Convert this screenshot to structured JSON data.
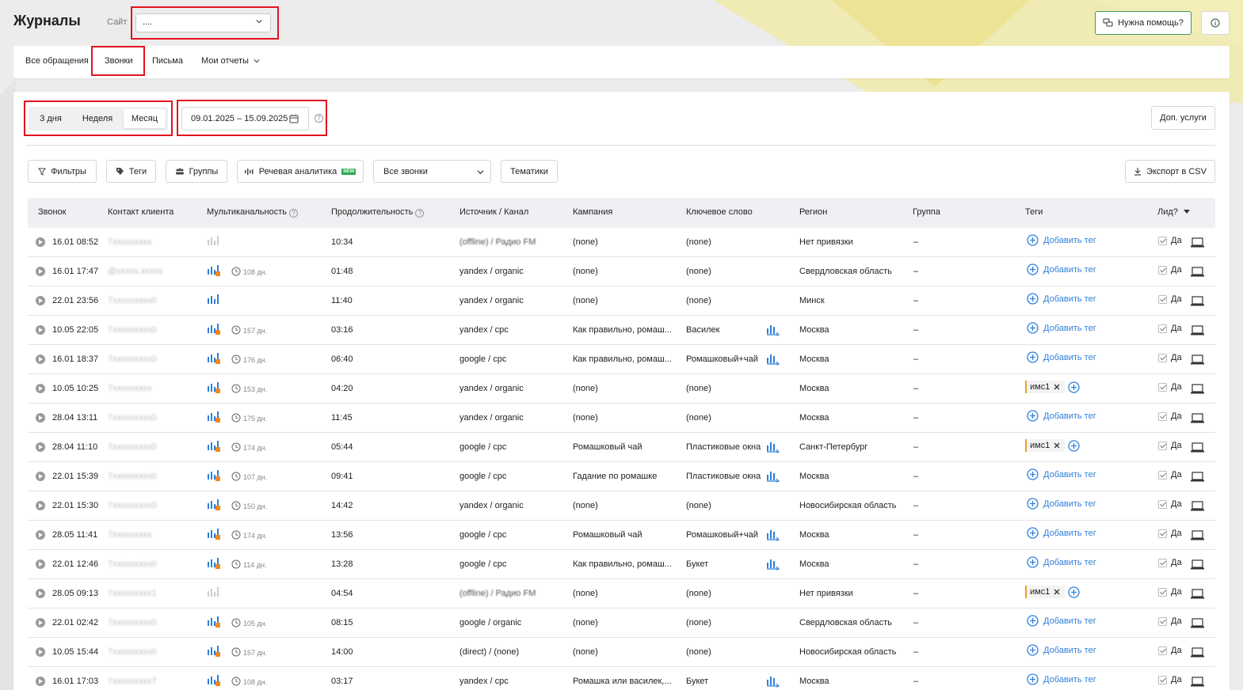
{
  "header": {
    "title": "Журналы",
    "site_label": "Сайт",
    "site_value": "....",
    "help_label": "Нужна помощь?"
  },
  "tabs": [
    {
      "label": "Все обращения"
    },
    {
      "label": "Звонки"
    },
    {
      "label": "Письма"
    },
    {
      "label": "Мои отчеты"
    }
  ],
  "period": {
    "options": [
      "3 дня",
      "Неделя",
      "Месяц"
    ],
    "active": "Месяц",
    "date_range": "09.01.2025 – 15.09.2025"
  },
  "extra_services_label": "Доп. услуги",
  "toolbar": {
    "filters": "Фильтры",
    "tags": "Теги",
    "groups": "Группы",
    "speech": "Речевая аналитика",
    "new_badge": "NEW",
    "calls_select": "Все звонки",
    "topics": "Тематики",
    "export": "Экспорт в CSV"
  },
  "table": {
    "columns": [
      "Звонок",
      "Контакт клиента",
      "Мультиканальность",
      "Продолжительность",
      "Источник / Канал",
      "Кампания",
      "Ключевое слово",
      "Регион",
      "Группа",
      "Теги",
      "Лид?"
    ],
    "add_tag_label": "Добавить тег",
    "lead_label": "Да",
    "rows": [
      {
        "date": "16.01 08:52",
        "contact": "7ххххххххх",
        "mc": "single",
        "days": "",
        "duration": "10:34",
        "source": "(offline) / Радио FM",
        "campaign": "(none)",
        "keyword": "(none)",
        "kw_icon": false,
        "region": "Нет привязки",
        "group": "–",
        "tag": ""
      },
      {
        "date": "16.01 17:47",
        "contact": "@ххххх.ххххх",
        "mc": "multi",
        "days": "108 дн.",
        "duration": "01:48",
        "source": "yandex / organic",
        "campaign": "(none)",
        "keyword": "(none)",
        "kw_icon": false,
        "region": "Свердловская область",
        "group": "–",
        "tag": ""
      },
      {
        "date": "22.01 23:56",
        "contact": "7ххххххххх0",
        "mc": "plain",
        "days": "",
        "duration": "11:40",
        "source": "yandex / organic",
        "campaign": "(none)",
        "keyword": "(none)",
        "kw_icon": false,
        "region": "Минск",
        "group": "–",
        "tag": ""
      },
      {
        "date": "10.05 22:05",
        "contact": "7ххххххххх0",
        "mc": "multi",
        "days": "157 дн.",
        "duration": "03:16",
        "source": "yandex / cpc",
        "campaign": "Как правильно, ромаш...",
        "keyword": "Василек",
        "kw_icon": true,
        "region": "Москва",
        "group": "–",
        "tag": ""
      },
      {
        "date": "16.01 18:37",
        "contact": "7ххххххххх0",
        "mc": "multi",
        "days": "176 дн.",
        "duration": "06:40",
        "source": "google / cpc",
        "campaign": "Как правильно, ромаш...",
        "keyword": "Ромашковый+чай",
        "kw_icon": true,
        "region": "Москва",
        "group": "–",
        "tag": ""
      },
      {
        "date": "10.05 10:25",
        "contact": "7ххххххххх",
        "mc": "multi",
        "days": "153 дн.",
        "duration": "04:20",
        "source": "yandex / organic",
        "campaign": "(none)",
        "keyword": "(none)",
        "kw_icon": false,
        "region": "Москва",
        "group": "–",
        "tag": "имс1"
      },
      {
        "date": "28.04 13:11",
        "contact": "7ххххххххх0",
        "mc": "multi",
        "days": "175 дн.",
        "duration": "11:45",
        "source": "yandex / organic",
        "campaign": "(none)",
        "keyword": "(none)",
        "kw_icon": false,
        "region": "Москва",
        "group": "–",
        "tag": ""
      },
      {
        "date": "28.04 11:10",
        "contact": "7ххххххххх0",
        "mc": "multi",
        "days": "174 дн.",
        "duration": "05:44",
        "source": "google / cpc",
        "campaign": "Ромашковый чай",
        "keyword": "Пластиковые окна",
        "kw_icon": true,
        "region": "Санкт-Петербург",
        "group": "–",
        "tag": "имс1"
      },
      {
        "date": "22.01 15:39",
        "contact": "7ххххххххх0",
        "mc": "multi",
        "days": "107 дн.",
        "duration": "09:41",
        "source": "google / cpc",
        "campaign": "Гадание по ромашке",
        "keyword": "Пластиковые окна",
        "kw_icon": true,
        "region": "Москва",
        "group": "–",
        "tag": ""
      },
      {
        "date": "22.01 15:30",
        "contact": "7ххххххххх0",
        "mc": "multi",
        "days": "150 дн.",
        "duration": "14:42",
        "source": "yandex / organic",
        "campaign": "(none)",
        "keyword": "(none)",
        "kw_icon": false,
        "region": "Новосибирская область",
        "group": "–",
        "tag": ""
      },
      {
        "date": "28.05 11:41",
        "contact": "7ххххххххх",
        "mc": "multi",
        "days": "174 дн.",
        "duration": "13:56",
        "source": "google / cpc",
        "campaign": "Ромашковый чай",
        "keyword": "Ромашковый+чай",
        "kw_icon": true,
        "region": "Москва",
        "group": "–",
        "tag": ""
      },
      {
        "date": "22.01 12:46",
        "contact": "7ххххххххх0",
        "mc": "multi",
        "days": "114 дн.",
        "duration": "13:28",
        "source": "google / cpc",
        "campaign": "Как правильно, ромаш...",
        "keyword": "Букет",
        "kw_icon": true,
        "region": "Москва",
        "group": "–",
        "tag": ""
      },
      {
        "date": "28.05 09:13",
        "contact": "7ххххххххх1",
        "mc": "single",
        "days": "",
        "duration": "04:54",
        "source": "(offline) / Радио FM",
        "campaign": "(none)",
        "keyword": "(none)",
        "kw_icon": false,
        "region": "Нет привязки",
        "group": "–",
        "tag": "имс1"
      },
      {
        "date": "22.01 02:42",
        "contact": "7ххххххххх0",
        "mc": "multi",
        "days": "105 дн.",
        "duration": "08:15",
        "source": "google / organic",
        "campaign": "(none)",
        "keyword": "(none)",
        "kw_icon": false,
        "region": "Свердловская область",
        "group": "–",
        "tag": ""
      },
      {
        "date": "10.05 15:44",
        "contact": "7ххххххххх0",
        "mc": "multi",
        "days": "157 дн.",
        "duration": "14:00",
        "source": "(direct) / (none)",
        "campaign": "(none)",
        "keyword": "(none)",
        "kw_icon": false,
        "region": "Новосибирская область",
        "group": "–",
        "tag": ""
      },
      {
        "date": "16.01 17:03",
        "contact": "7ххххххххх7",
        "mc": "multi",
        "days": "108 дн.",
        "duration": "03:17",
        "source": "yandex / cpc",
        "campaign": "Ромашка или василек,...",
        "keyword": "Букет",
        "kw_icon": true,
        "region": "Москва",
        "group": "–",
        "tag": ""
      }
    ]
  },
  "colors": {
    "accent_blue": "#2e7fdb",
    "highlight_red": "#e0141e",
    "badge_green": "#2fa84f",
    "tag_orange": "#f0a020"
  }
}
